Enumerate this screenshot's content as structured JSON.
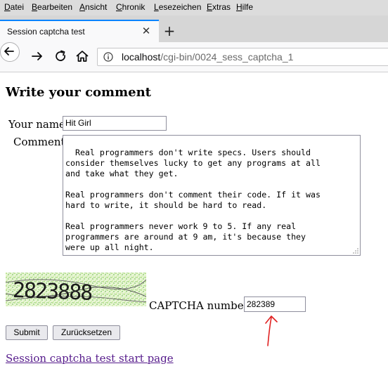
{
  "menu": [
    "Datei",
    "Bearbeiten",
    "Ansicht",
    "Chronik",
    "Lesezeichen",
    "Extras",
    "Hilfe"
  ],
  "tab": {
    "title": "Session captcha test",
    "close": "✕",
    "new_tab": "+"
  },
  "url": {
    "host": "localhost",
    "path": "/cgi-bin/0024_sess_captcha_1"
  },
  "page": {
    "heading": "Write your comment",
    "name_label": "Your name:",
    "name_value": "Hit Girl",
    "comment_label": "Comment:",
    "comment_text": "Real programmers don't write specs. Users should\nconsider themselves lucky to get any programs at all\nand take what they get.\n\nReal programmers don't comment their code. If it was\nhard to write, it should be hard to read.\n\nReal programmers never work 9 to 5. If any real\nprogrammers are around at 9 am, it's because they\nwere up all night.",
    "captcha_label": "CAPTCHA number:",
    "captcha_value": "282389",
    "captcha_image_digits": "2823888",
    "submit_label": "Submit",
    "reset_label": "Zurücksetzen",
    "link_text": "Session captcha test start page"
  },
  "colors": {
    "link": "#551a8b",
    "tab_accent": "#0a84ff",
    "annotation_arrow": "#e02020"
  }
}
